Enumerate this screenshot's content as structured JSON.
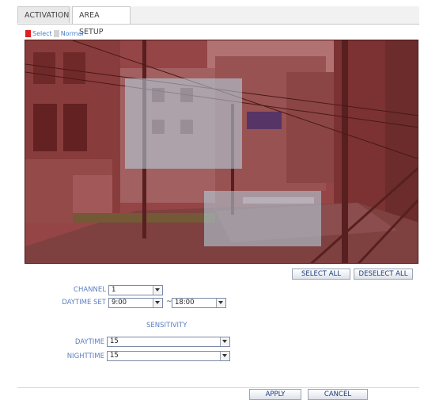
{
  "tabs": [
    {
      "label": "ACTIVATION"
    },
    {
      "label": "AREA SETUP"
    }
  ],
  "legend": {
    "select_label": "Select",
    "normal_label": "Normal",
    "select_color": "#e21f1f",
    "normal_color": "#d3d3d3"
  },
  "buttons": {
    "select_all": "SELECT ALL",
    "deselect_all": "DESELECT ALL",
    "apply": "APPLY",
    "cancel": "CANCEL"
  },
  "form": {
    "channel_label": "CHANNEL",
    "channel_value": "1",
    "daytime_set_label": "DAYTIME SET",
    "daytime_start": "9:00",
    "daytime_separator": "~",
    "daytime_end": "18:00",
    "sensitivity_heading": "SENSITIVITY",
    "daytime_label": "DAYTIME",
    "daytime_value": "15",
    "nighttime_label": "NIGHTTIME",
    "nighttime_value": "15"
  }
}
